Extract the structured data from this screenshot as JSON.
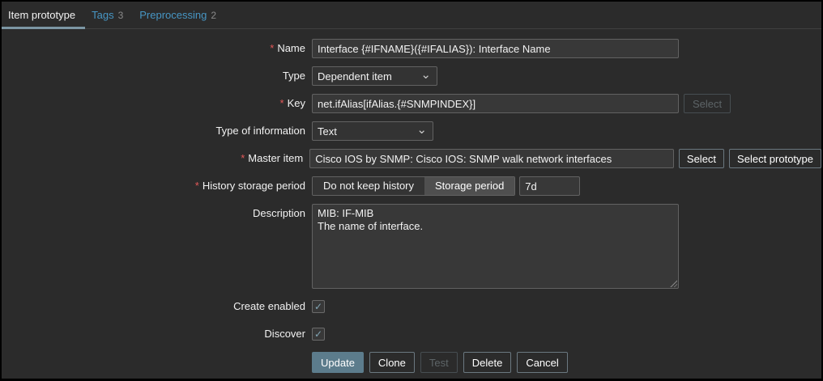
{
  "tabs": {
    "items": [
      {
        "label": "Item prototype",
        "active": true
      },
      {
        "label": "Tags",
        "badge": "3"
      },
      {
        "label": "Preprocessing",
        "badge": "2"
      }
    ]
  },
  "form": {
    "required_marker": "*",
    "fields": {
      "name": {
        "label": "Name",
        "value": "Interface {#IFNAME}({#IFALIAS}): Interface Name"
      },
      "type": {
        "label": "Type",
        "value": "Dependent item"
      },
      "key": {
        "label": "Key",
        "value": "net.ifAlias[ifAlias.{#SNMPINDEX}]",
        "select_button": "Select"
      },
      "type_of_information": {
        "label": "Type of information",
        "value": "Text"
      },
      "master_item": {
        "label": "Master item",
        "value": "Cisco IOS by SNMP: Cisco IOS: SNMP walk network interfaces",
        "select_button": "Select",
        "select_prototype_button": "Select prototype"
      },
      "history_storage_period": {
        "label": "History storage period",
        "options": [
          "Do not keep history",
          "Storage period"
        ],
        "selected": "Storage period",
        "value": "7d"
      },
      "description": {
        "label": "Description",
        "value": "MIB: IF-MIB\nThe name of interface."
      },
      "create_enabled": {
        "label": "Create enabled",
        "checked": true
      },
      "discover": {
        "label": "Discover",
        "checked": true
      }
    },
    "buttons": {
      "update": "Update",
      "clone": "Clone",
      "test": "Test",
      "delete": "Delete",
      "cancel": "Cancel"
    }
  },
  "icons": {
    "chevron_down": "⌄",
    "checkmark": "✓"
  },
  "colors": {
    "accent_link": "#4796c4",
    "tab_underline": "#7c96a4",
    "required_red": "#e45959",
    "primary_button": "#5c7c8c",
    "checkbox_check": "#82a5b4"
  }
}
